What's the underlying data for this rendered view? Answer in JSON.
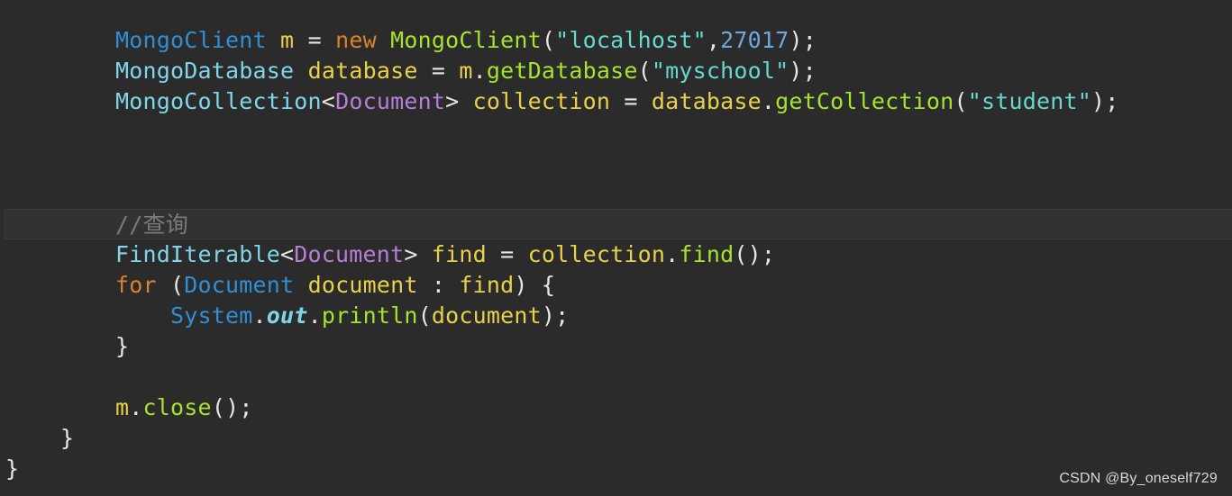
{
  "code_lines": [
    {
      "indent": "        ",
      "tokens": [
        {
          "t": "MongoClient",
          "c": "#2f8fd6"
        },
        {
          "t": " ",
          "c": "#e6e6e6"
        },
        {
          "t": "m",
          "c": "#e8d14a"
        },
        {
          "t": " = ",
          "c": "#e6e6e6"
        },
        {
          "t": "new",
          "c": "#d9822b"
        },
        {
          "t": " ",
          "c": "#e6e6e6"
        },
        {
          "t": "MongoClient",
          "c": "#a6e22e"
        },
        {
          "t": "(",
          "c": "#e6e6e6"
        },
        {
          "t": "\"localhost\"",
          "c": "#66d9ca"
        },
        {
          "t": ",",
          "c": "#e6e6e6"
        },
        {
          "t": "27017",
          "c": "#6fa8dc"
        },
        {
          "t": ");",
          "c": "#e6e6e6"
        }
      ]
    },
    {
      "indent": "        ",
      "tokens": [
        {
          "t": "MongoDatabase",
          "c": "#7fd6e8"
        },
        {
          "t": " ",
          "c": "#e6e6e6"
        },
        {
          "t": "database",
          "c": "#e8d14a"
        },
        {
          "t": " = ",
          "c": "#e6e6e6"
        },
        {
          "t": "m",
          "c": "#e8d14a"
        },
        {
          "t": ".",
          "c": "#e6e6e6"
        },
        {
          "t": "getDatabase",
          "c": "#a6e22e"
        },
        {
          "t": "(",
          "c": "#e6e6e6"
        },
        {
          "t": "\"myschool\"",
          "c": "#66d9ca"
        },
        {
          "t": ");",
          "c": "#e6e6e6"
        }
      ]
    },
    {
      "indent": "        ",
      "tokens": [
        {
          "t": "MongoCollection",
          "c": "#7fd6e8"
        },
        {
          "t": "<",
          "c": "#e6e6e6"
        },
        {
          "t": "Document",
          "c": "#b57fd8"
        },
        {
          "t": "> ",
          "c": "#e6e6e6"
        },
        {
          "t": "collection",
          "c": "#e8d14a"
        },
        {
          "t": " = ",
          "c": "#e6e6e6"
        },
        {
          "t": "database",
          "c": "#e8d14a"
        },
        {
          "t": ".",
          "c": "#e6e6e6"
        },
        {
          "t": "getCollection",
          "c": "#a6e22e"
        },
        {
          "t": "(",
          "c": "#e6e6e6"
        },
        {
          "t": "\"student\"",
          "c": "#66d9ca"
        },
        {
          "t": ");",
          "c": "#e6e6e6"
        }
      ]
    },
    {
      "indent": "",
      "tokens": []
    },
    {
      "indent": "",
      "tokens": []
    },
    {
      "indent": "",
      "tokens": []
    },
    {
      "indent": "        ",
      "current": true,
      "tokens": [
        {
          "t": "//查询",
          "c": "#7a7a7a"
        }
      ]
    },
    {
      "indent": "        ",
      "tokens": [
        {
          "t": "FindIterable",
          "c": "#7fd6e8"
        },
        {
          "t": "<",
          "c": "#e6e6e6"
        },
        {
          "t": "Document",
          "c": "#b57fd8"
        },
        {
          "t": "> ",
          "c": "#e6e6e6"
        },
        {
          "t": "find",
          "c": "#e8d14a"
        },
        {
          "t": " = ",
          "c": "#e6e6e6"
        },
        {
          "t": "collection",
          "c": "#e8d14a"
        },
        {
          "t": ".",
          "c": "#e6e6e6"
        },
        {
          "t": "find",
          "c": "#a6e22e"
        },
        {
          "t": "();",
          "c": "#e6e6e6"
        }
      ]
    },
    {
      "indent": "        ",
      "tokens": [
        {
          "t": "for",
          "c": "#d9822b"
        },
        {
          "t": " (",
          "c": "#e6e6e6"
        },
        {
          "t": "Document",
          "c": "#2f8fd6"
        },
        {
          "t": " ",
          "c": "#e6e6e6"
        },
        {
          "t": "document",
          "c": "#e8d14a"
        },
        {
          "t": " : ",
          "c": "#e6e6e6"
        },
        {
          "t": "find",
          "c": "#e8d14a"
        },
        {
          "t": ") {",
          "c": "#e6e6e6"
        }
      ]
    },
    {
      "indent": "            ",
      "tokens": [
        {
          "t": "System",
          "c": "#2f8fd6"
        },
        {
          "t": ".",
          "c": "#e6e6e6"
        },
        {
          "t": "out",
          "c": "#7fd6e8",
          "style": "bold-italic"
        },
        {
          "t": ".",
          "c": "#e6e6e6"
        },
        {
          "t": "println",
          "c": "#a6e22e"
        },
        {
          "t": "(",
          "c": "#e6e6e6"
        },
        {
          "t": "document",
          "c": "#e8d14a"
        },
        {
          "t": ");",
          "c": "#e6e6e6"
        }
      ]
    },
    {
      "indent": "        ",
      "tokens": [
        {
          "t": "}",
          "c": "#e6e6e6"
        }
      ]
    },
    {
      "indent": "",
      "tokens": []
    },
    {
      "indent": "        ",
      "tokens": [
        {
          "t": "m",
          "c": "#e8d14a"
        },
        {
          "t": ".",
          "c": "#e6e6e6"
        },
        {
          "t": "close",
          "c": "#a6e22e"
        },
        {
          "t": "();",
          "c": "#e6e6e6"
        }
      ]
    },
    {
      "indent": "    ",
      "tokens": [
        {
          "t": "}",
          "c": "#e6e6e6"
        }
      ]
    },
    {
      "indent": "",
      "tokens": [
        {
          "t": "}",
          "c": "#e6e6e6"
        }
      ]
    }
  ],
  "watermark": "CSDN @By_oneself729",
  "colors": {
    "background": "#2b2b2b",
    "current_line": "#323232"
  }
}
